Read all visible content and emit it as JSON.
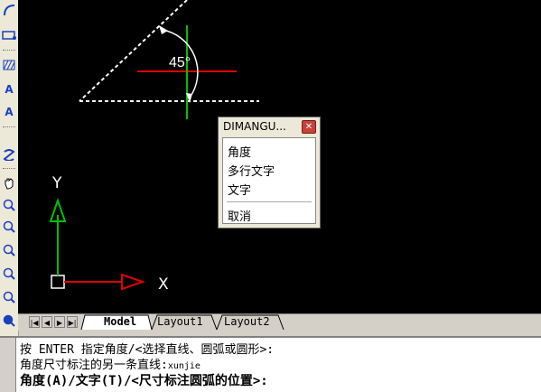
{
  "toolbar": {
    "icons": [
      "arc-icon",
      "rectangle-icon",
      "hatch-icon",
      "text-icon",
      "mtext-icon",
      "region-icon",
      "pan-icon",
      "zoom-realtime-icon",
      "zoom-window-icon",
      "zoom-previous-icon",
      "zoom-in-icon",
      "zoom-out-icon",
      "zoom-all-icon"
    ]
  },
  "drawing": {
    "angle_label": "45°",
    "ucs_x_label": "X",
    "ucs_y_label": "Y"
  },
  "tabs": {
    "nav": [
      "|◀",
      "◀",
      "▶",
      "▶|"
    ],
    "model": "Model",
    "layout1": "Layout1",
    "layout2": "Layout2"
  },
  "popup": {
    "title": "DIMANGU...",
    "items": [
      "角度",
      "多行文字",
      "文字",
      "取消"
    ]
  },
  "command": {
    "line1": "按 ENTER 指定角度/<选择直线、圆弧或圆形>:",
    "line2_prefix": "角度尺寸标注的另一条直线:",
    "line2_suffix": "xunjie",
    "line3": "角度(A)/文字(T)/<尺寸标注圆弧的位置>:"
  }
}
